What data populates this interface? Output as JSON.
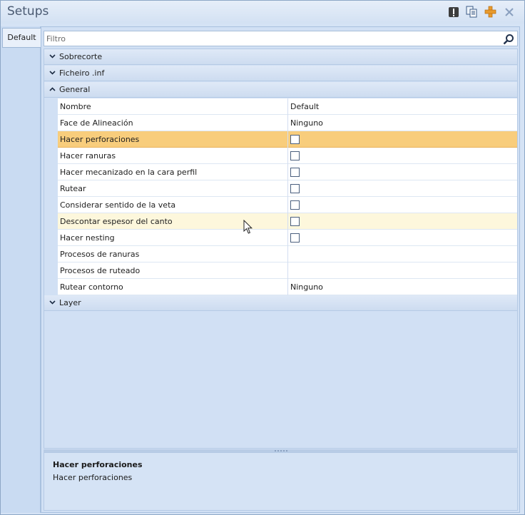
{
  "window": {
    "title": "Setups"
  },
  "toolbar": {
    "icons": [
      "info-icon",
      "copy-icon",
      "add-icon",
      "close-icon"
    ],
    "accent_add": "#e89a2c"
  },
  "tabs": [
    {
      "label": "Default",
      "active": true
    }
  ],
  "filter": {
    "placeholder": "Filtro",
    "value": ""
  },
  "categories": [
    {
      "label": "Sobrecorte",
      "expanded": false
    },
    {
      "label": "Ficheiro .inf",
      "expanded": false
    },
    {
      "label": "General",
      "expanded": true
    },
    {
      "label": "Layer",
      "expanded": false
    }
  ],
  "properties": [
    {
      "name": "Nombre",
      "value": "Default",
      "type": "text"
    },
    {
      "name": "Face de Alineación",
      "value": "Ninguno",
      "type": "text"
    },
    {
      "name": "Hacer perforaciones",
      "checked": false,
      "type": "checkbox",
      "state": "selected"
    },
    {
      "name": "Hacer ranuras",
      "checked": false,
      "type": "checkbox"
    },
    {
      "name": "Hacer mecanizado en la cara perfil",
      "checked": false,
      "type": "checkbox"
    },
    {
      "name": "Rutear",
      "checked": false,
      "type": "checkbox"
    },
    {
      "name": "Considerar sentido de la veta",
      "checked": false,
      "type": "checkbox"
    },
    {
      "name": "Descontar espesor del canto",
      "checked": false,
      "type": "checkbox",
      "state": "hover"
    },
    {
      "name": "Hacer nesting",
      "checked": false,
      "type": "checkbox"
    },
    {
      "name": "Procesos de ranuras",
      "value": "",
      "type": "text"
    },
    {
      "name": "Procesos de ruteado",
      "value": "",
      "type": "text"
    },
    {
      "name": "Rutear contorno",
      "value": "Ninguno",
      "type": "text"
    }
  ],
  "description": {
    "title": "Hacer perforaciones",
    "text": "Hacer perforaciones"
  },
  "colors": {
    "selected_row": "#f8cd7c",
    "hover_row": "#fdf7dc",
    "panel_bg": "#d1e0f4"
  }
}
